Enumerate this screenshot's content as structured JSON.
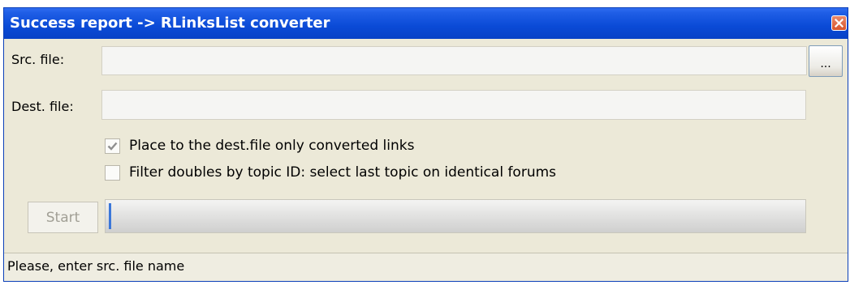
{
  "window": {
    "title": "Success report -> RLinksList converter",
    "close_icon": "close-icon",
    "accent_color": "#0a4ad6",
    "close_color": "#d9542c"
  },
  "form": {
    "src_label": "Src. file:",
    "src_value": "",
    "browse_label": "...",
    "dest_label": "Dest. file:",
    "dest_value": ""
  },
  "options": [
    {
      "label": "Place to the dest.file only converted links",
      "checked": true
    },
    {
      "label": "Filter doubles by topic ID: select last topic on identical forums",
      "checked": false
    }
  ],
  "actions": {
    "start_label": "Start",
    "start_enabled": false,
    "progress_fraction": 0
  },
  "status": {
    "text": "Please, enter src. file name"
  }
}
